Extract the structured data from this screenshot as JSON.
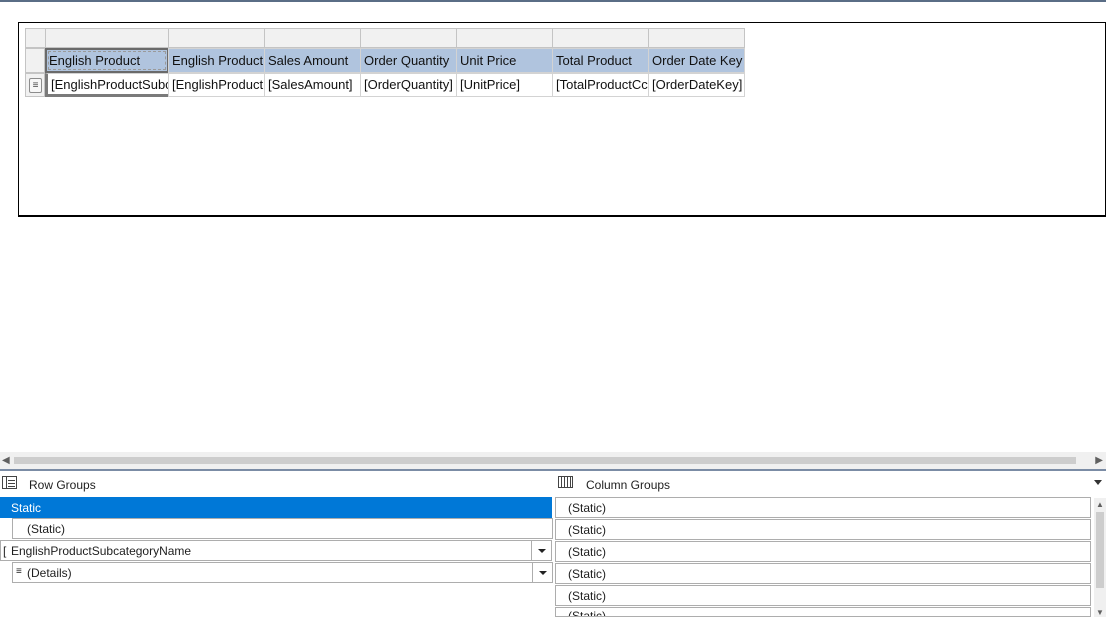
{
  "tablix": {
    "headers": [
      "English Product",
      "English Product",
      "Sales Amount",
      "Order Quantity",
      "Unit Price",
      "Total Product",
      "Order Date Key"
    ],
    "details": [
      "[EnglishProductSubc",
      "[EnglishProduct",
      "[SalesAmount]",
      "[OrderQuantity]",
      "[UnitPrice]",
      "[TotalProductCc",
      "[OrderDateKey]"
    ],
    "row_handle_icon": "details-lines-icon",
    "colors": {
      "header_fill": "#b0c4de",
      "handle_fill": "#f1f1f1"
    }
  },
  "grouping": {
    "row_groups_title": "Row Groups",
    "column_groups_title": "Column Groups",
    "row_groups": [
      "Static",
      "(Static)",
      "EnglishProductSubcategoryName",
      "(Details)"
    ],
    "column_groups": [
      "(Static)",
      "(Static)",
      "(Static)",
      "(Static)",
      "(Static)",
      "(Static)"
    ],
    "selected_color": "#0078d7"
  }
}
